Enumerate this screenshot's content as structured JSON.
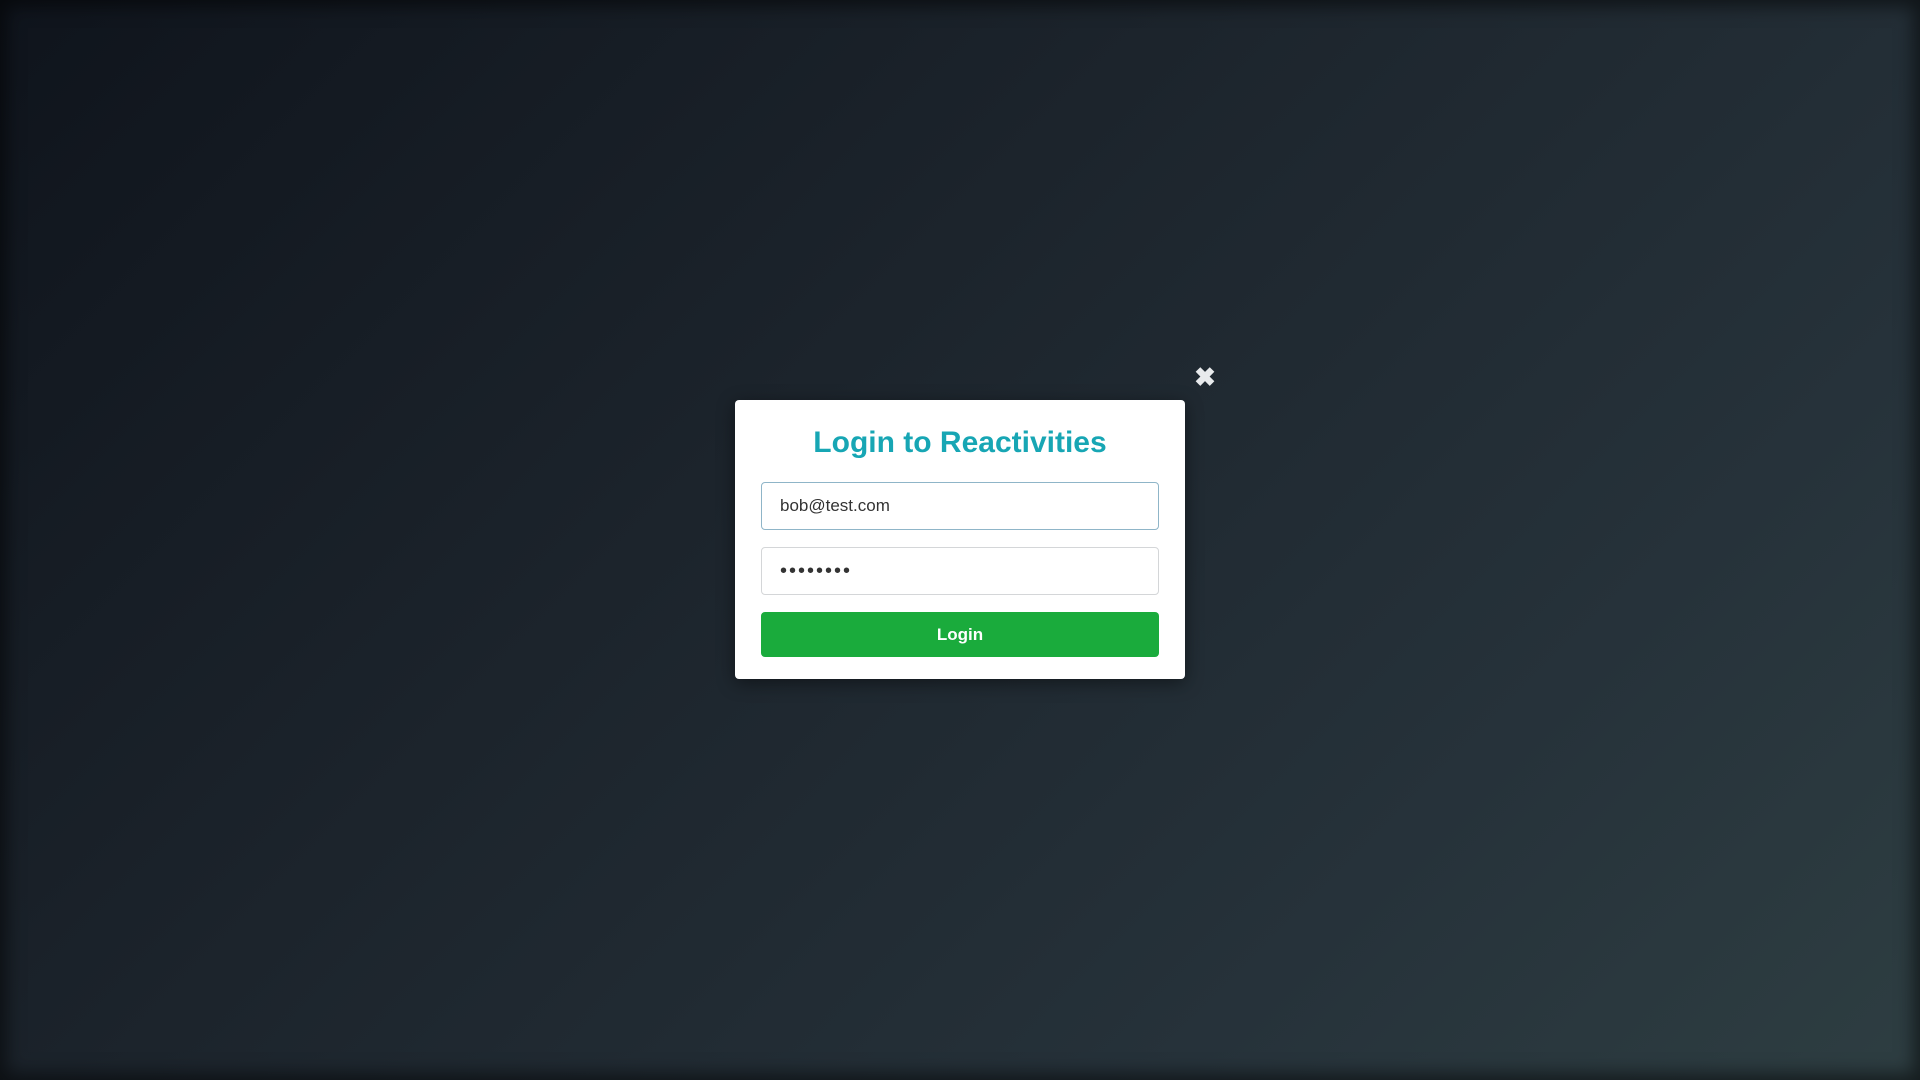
{
  "modal": {
    "title": "Login to Reactivities",
    "close_icon": "close-icon",
    "close_glyph": "✖"
  },
  "form": {
    "email_value": "bob@test.com",
    "password_value": "••••••••",
    "login_label": "Login"
  },
  "colors": {
    "title": "#17a6b4",
    "login_button": "#1aab3c",
    "modal_background": "#ffffff"
  }
}
